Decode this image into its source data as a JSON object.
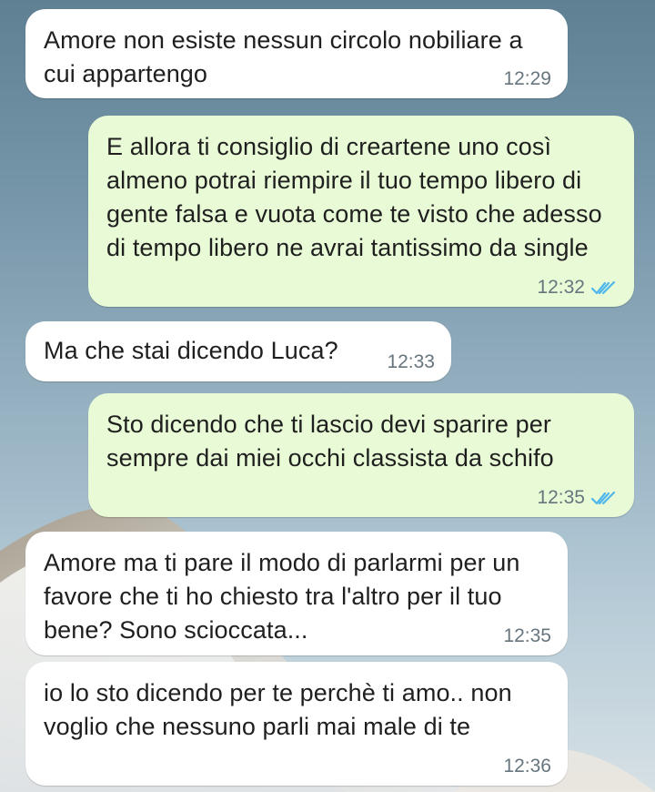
{
  "messages": [
    {
      "direction": "incoming",
      "text": "Amore non esiste nessun circolo nobiliare a cui appartengo",
      "time": "12:29"
    },
    {
      "direction": "outgoing",
      "text": "E allora ti consiglio di creartene uno così almeno potrai riempire il tuo tempo libero di gente falsa e vuota come te visto che adesso di tempo libero ne avrai tantissimo da single",
      "time": "12:32",
      "status": "read"
    },
    {
      "direction": "incoming",
      "text": "Ma che stai dicendo Luca?",
      "time": "12:33"
    },
    {
      "direction": "outgoing",
      "text": "Sto dicendo che ti lascio devi sparire per sempre dai miei occhi classista da schifo",
      "time": "12:35",
      "status": "read"
    },
    {
      "direction": "incoming",
      "text": "Amore ma ti pare il modo di parlarmi per un favore che ti ho chiesto tra l'altro per il tuo bene? Sono scioccata...",
      "time": "12:35"
    },
    {
      "direction": "incoming",
      "text": "io lo sto dicendo per te perchè ti amo.. non voglio che nessuno parli mai male di te",
      "time": "12:36"
    }
  ],
  "icons": {
    "read_receipt": "double-check-icon"
  },
  "colors": {
    "incoming_bubble": "#ffffff",
    "outgoing_bubble": "#e9fbd6",
    "timestamp": "#66757e",
    "read_receipt": "#4fb6ec"
  }
}
